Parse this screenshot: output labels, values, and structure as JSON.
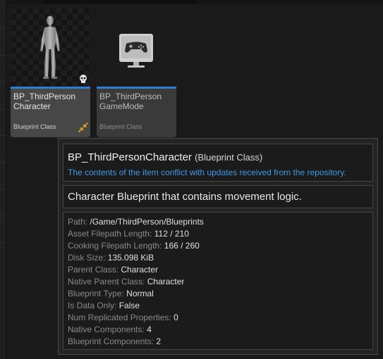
{
  "assets": [
    {
      "name_line1": "BP_ThirdPerson",
      "name_line2": "Character",
      "class_label": "Blueprint Class",
      "thumbnail": "mannequin-figure",
      "overlay_icon": "skull-icon",
      "status_icon": "conflict-arrows-icon",
      "selected": true
    },
    {
      "name_line1": "BP_ThirdPerson",
      "name_line2": "GameMode",
      "class_label": "Blueprint Class",
      "thumbnail": "gamepad-monitor-icon",
      "selected": false
    }
  ],
  "tooltip": {
    "title": "BP_ThirdPersonCharacter",
    "type": "(Blueprint Class)",
    "conflict_message": "The contents of the item conflict with updates received from the repository.",
    "description": "Character Blueprint that contains movement logic.",
    "properties": [
      {
        "key": "Path:",
        "value": "/Game/ThirdPerson/Blueprints"
      },
      {
        "key": "Asset Filepath Length:",
        "value": "112 / 210"
      },
      {
        "key": "Cooking Filepath Length:",
        "value": "166 / 260"
      },
      {
        "key": "Disk Size:",
        "value": "135.098 KiB"
      },
      {
        "key": "Parent Class:",
        "value": "Character"
      },
      {
        "key": "Native Parent Class:",
        "value": "Character"
      },
      {
        "key": "Blueprint Type:",
        "value": "Normal"
      },
      {
        "key": "Is Data Only:",
        "value": "False"
      },
      {
        "key": "Num Replicated Properties:",
        "value": "0"
      },
      {
        "key": "Native Components:",
        "value": "4"
      },
      {
        "key": "Blueprint Components:",
        "value": "2"
      }
    ]
  },
  "colors": {
    "accent_blue": "#2f7bd6",
    "conflict_text": "#3d9ae8",
    "conflict_icon": "#e8a317"
  }
}
